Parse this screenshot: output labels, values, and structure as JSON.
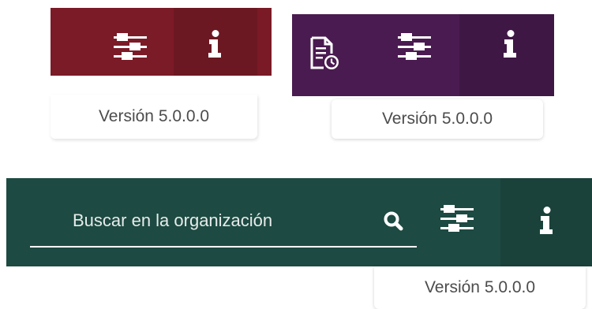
{
  "toolbars": {
    "red": {
      "accent": "#7b1b27",
      "version_label": "Versión 5.0.0.0",
      "icons": [
        "settings-sliders-icon",
        "info-icon"
      ]
    },
    "purple": {
      "accent": "#4a1b50",
      "version_label": "Versión 5.0.0.0",
      "icons": [
        "document-history-icon",
        "settings-sliders-icon",
        "info-icon"
      ]
    },
    "green": {
      "accent": "#1d4a42",
      "version_label": "Versión 5.0.0.0",
      "search": {
        "placeholder": "Buscar en la organización",
        "value": ""
      },
      "icons": [
        "search-icon",
        "settings-sliders-icon",
        "info-icon"
      ]
    }
  }
}
